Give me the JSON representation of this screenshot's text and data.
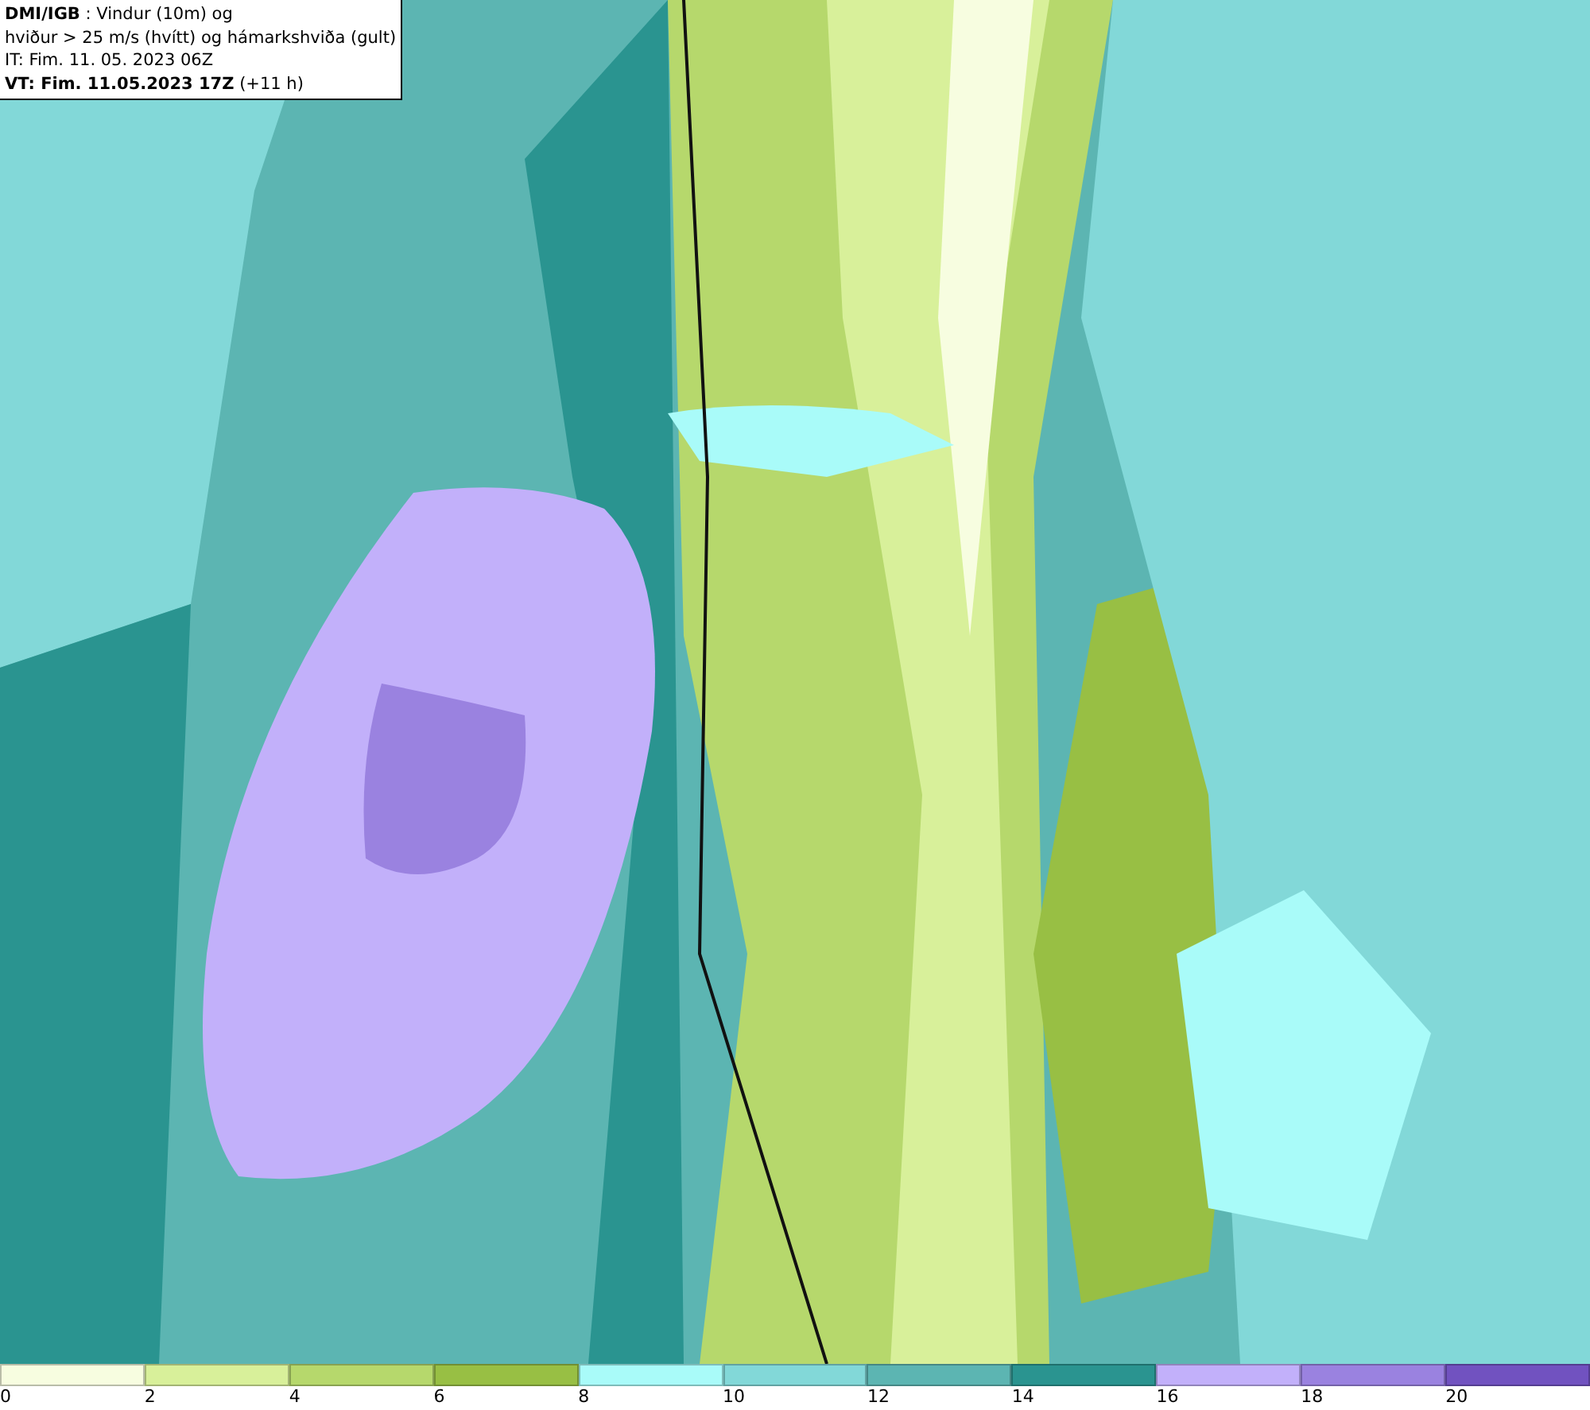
{
  "header": {
    "lines": [
      "**DMI/IGB** : Vindur (10m) og",
      "hviður > 25 m/s (hvítt) og hámarkshviða (gult)",
      "IT: Fim. 11. 05. 2023 06Z",
      "**VT: Fim. 11.05.2023 17Z** (+11 h)"
    ]
  },
  "legend": {
    "bins": [
      {
        "color": "#f7fde0",
        "label": "0"
      },
      {
        "color": "#d8f09a",
        "label": "2"
      },
      {
        "color": "#b6d86c",
        "label": "4"
      },
      {
        "color": "#98bf44",
        "label": "6"
      },
      {
        "color": "#a9fbf9",
        "label": "8"
      },
      {
        "color": "#82d8d8",
        "label": "10"
      },
      {
        "color": "#5cb5b2",
        "label": "12"
      },
      {
        "color": "#2a9490",
        "label": "14"
      },
      {
        "color": "#c2b0fa",
        "label": "16"
      },
      {
        "color": "#9a82e0",
        "label": "18"
      },
      {
        "color": "#7152c0",
        "label": "20"
      }
    ]
  }
}
